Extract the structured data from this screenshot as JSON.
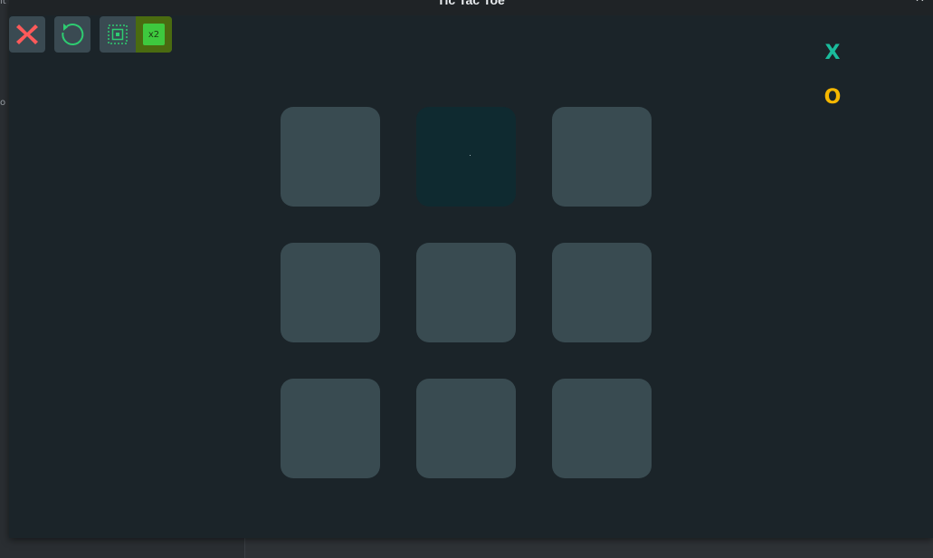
{
  "window": {
    "title": "Tic Tac Toe",
    "minimize_label": "–",
    "close_label": "✕"
  },
  "desktop": {
    "edge_glyph_1": "lt",
    "edge_glyph_2": "o"
  },
  "toolbar": {
    "quit_icon": "x-quit-icon",
    "restart_icon": "restart-icon",
    "layout_icon": "layout-icon",
    "speed_label": "x2",
    "colors": {
      "button_bg": "#3a4a52",
      "quit": "#ff5a5a",
      "restart": "#2ecc71",
      "x2_bg": "#4a6b10",
      "x2_chip": "#3ec93e"
    }
  },
  "legend": {
    "x_label": "X",
    "o_label": "O",
    "x_color": "#1abc9c",
    "o_color": "#f5b700"
  },
  "board": {
    "cells": [
      "",
      "",
      "",
      "",
      "",
      "",
      "",
      "",
      ""
    ],
    "highlighted_cell": 1,
    "cell_color": "#394b51",
    "highlight_color": "#0f2a30"
  }
}
